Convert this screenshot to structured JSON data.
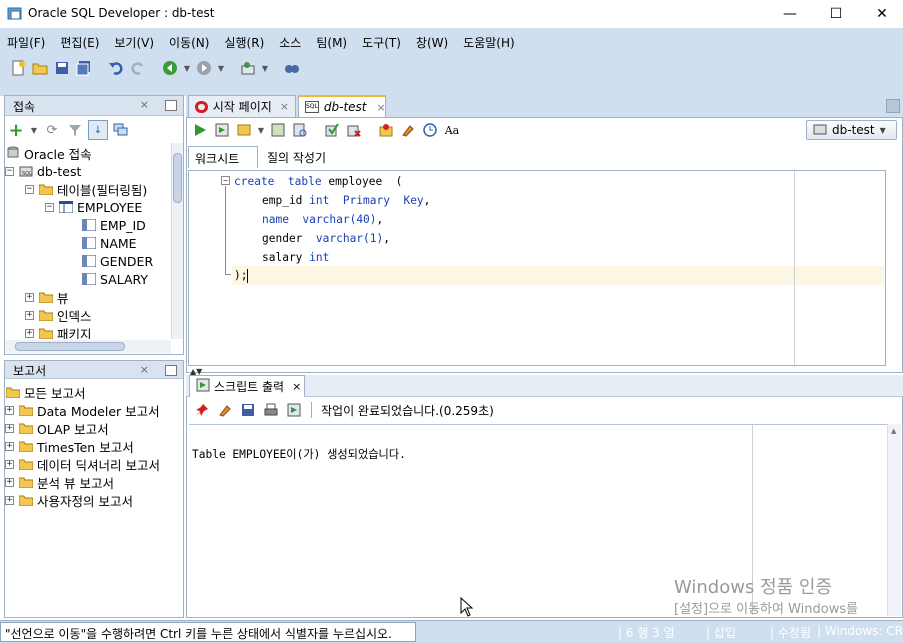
{
  "window": {
    "title": "Oracle SQL Developer : db-test"
  },
  "menu": {
    "items": [
      "파일(F)",
      "편집(E)",
      "보기(V)",
      "이동(N)",
      "실행(R)",
      "소스",
      "팀(M)",
      "도구(T)",
      "창(W)",
      "도움말(H)"
    ]
  },
  "connections_panel": {
    "title": "접속",
    "root": "Oracle 접속",
    "db": "db-test",
    "tables_node": "테이블(필터링됨)",
    "table": "EMPLOYEE",
    "columns": [
      "EMP_ID",
      "NAME",
      "GENDER",
      "SALARY"
    ],
    "others": [
      "뷰",
      "인덱스",
      "패키지"
    ]
  },
  "reports_panel": {
    "title": "보고서",
    "root": "모든 보고서",
    "items": [
      "Data Modeler 보고서",
      "OLAP 보고서",
      "TimesTen 보고서",
      "데이터 딕셔너리 보고서",
      "분석 뷰 보고서",
      "사용자정의 보고서"
    ]
  },
  "editor": {
    "tabs": [
      "시작 페이지",
      "db-test"
    ],
    "connection_selector": "db-test",
    "subtabs": [
      "워크시트",
      "질의 작성기"
    ],
    "code": {
      "l1_kw1": "create",
      "l1_kw2": "table",
      "l1_rest": " employee  (",
      "l2_name": "emp_id ",
      "l2_kw": "int  Primary  Key",
      "l2_end": ",",
      "l3_name": "name  ",
      "l3_kw": "varchar",
      "l3_num": "(40)",
      "l3_end": ",",
      "l4_name": "gender  ",
      "l4_kw": "varchar",
      "l4_num": "(1)",
      "l4_end": ",",
      "l5_name": "salary ",
      "l5_kw": "int",
      "l6": ");"
    }
  },
  "output": {
    "tab": "스크립트 출력",
    "status": "작업이 완료되었습니다.(0.259초)",
    "message": "Table EMPLOYEE이(가) 생성되었습니다."
  },
  "watermark": {
    "line1": "Windows 정품 인증",
    "line2": "[설정]으로 이동하여 Windows를"
  },
  "statusbar": {
    "hint": "\"선언으로 이동\"을 수행하려면 Ctrl 키를 누른 상태에서 식별자를 누르십시오.",
    "position": "6 행 3 열",
    "mode": "삽입",
    "modified": "수정됨",
    "eol": "Windows: CR"
  },
  "colors": {
    "chrome": "#cfdff0",
    "keyword": "#1c3fb8",
    "current_line": "#fbf7e4"
  }
}
